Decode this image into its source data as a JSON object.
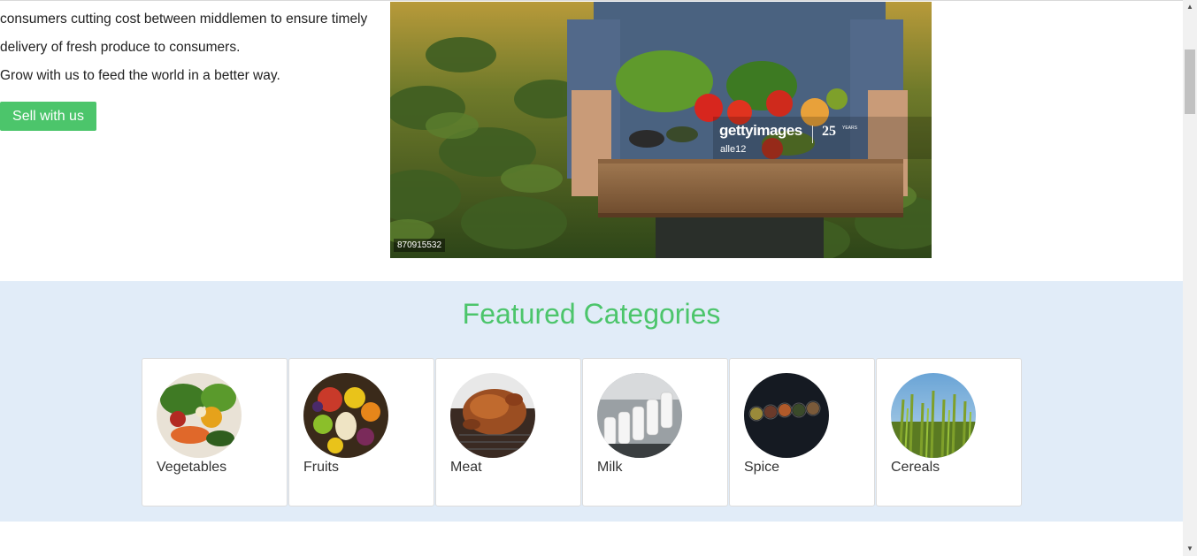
{
  "hero": {
    "lines": [
      "consumers cutting cost between middlemen to ensure timely",
      "delivery of fresh produce to consumers.",
      "Grow with us to feed the world in a better way."
    ],
    "sell_button_label": "Sell with us",
    "image": {
      "watermark_brand": "gettyimages",
      "watermark_badge": "25",
      "watermark_badge_sub": "YEARS",
      "watermark_user": "alle12",
      "image_id": "870915532"
    }
  },
  "featured": {
    "title": "Featured Categories",
    "categories": [
      {
        "label": "Vegetables",
        "icon": "vegetables-image"
      },
      {
        "label": "Fruits",
        "icon": "fruits-image"
      },
      {
        "label": "Meat",
        "icon": "meat-image"
      },
      {
        "label": "Milk",
        "icon": "milk-image"
      },
      {
        "label": "Spice",
        "icon": "spice-image"
      },
      {
        "label": "Cereals",
        "icon": "cereals-image"
      }
    ]
  },
  "scrollbar": {
    "up_icon": "chevron-up-icon",
    "down_icon": "chevron-down-icon"
  },
  "colors": {
    "accent": "#4cc56b",
    "section_bg": "#e1ecf8"
  }
}
